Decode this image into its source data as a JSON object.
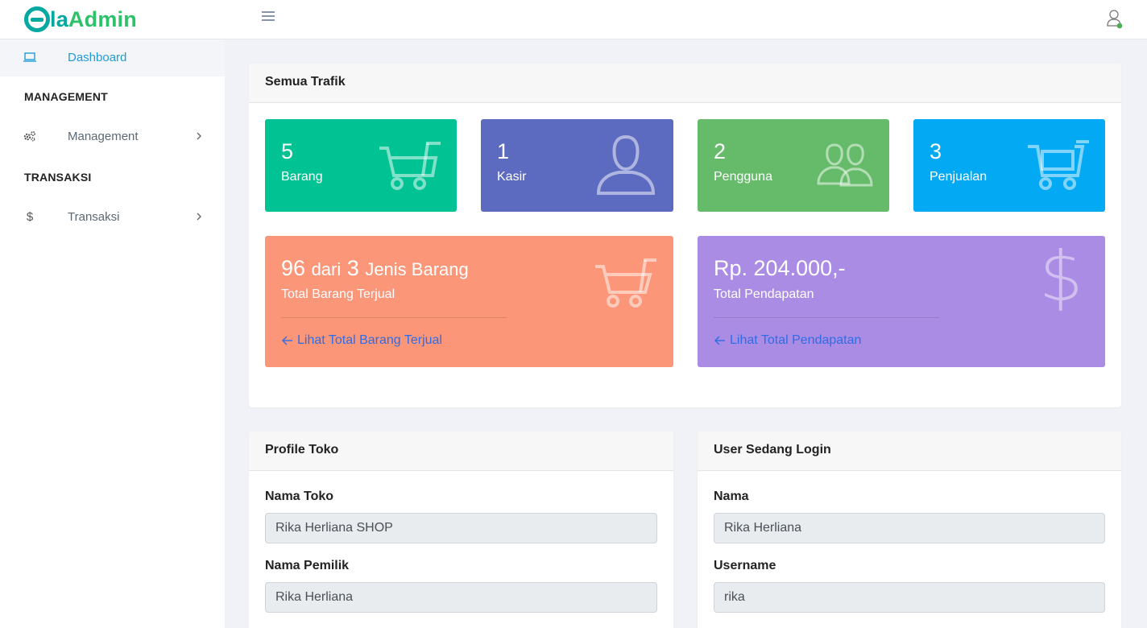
{
  "header": {
    "logo_prefix": "la",
    "logo_suffix": "Admin",
    "menu_icon": "hamburger-icon",
    "user_icon": "user-icon",
    "status_color": "#4caf50"
  },
  "sidebar": {
    "items": [
      {
        "label": "Dashboard",
        "icon": "laptop-icon",
        "active": true
      },
      {
        "label": "Management",
        "icon": "gears-icon",
        "active": false
      },
      {
        "label": "Transaksi",
        "icon": "dollar-icon",
        "active": false
      }
    ],
    "headings": [
      "MANAGEMENT",
      "TRANSAKSI"
    ]
  },
  "traffic": {
    "title": "Semua Trafik",
    "stats": [
      {
        "value": "5",
        "label": "Barang",
        "color": "#00c292",
        "icon": "cart-icon"
      },
      {
        "value": "1",
        "label": "Kasir",
        "color": "#5c6bc0",
        "icon": "user-icon"
      },
      {
        "value": "2",
        "label": "Pengguna",
        "color": "#66bb6a",
        "icon": "users-icon"
      },
      {
        "value": "3",
        "label": "Penjualan",
        "color": "#03a9f3",
        "icon": "basket-icon"
      }
    ],
    "sold": {
      "qty": "96",
      "of": "dari",
      "types": "3",
      "types_label": "Jenis Barang",
      "sub": "Total Barang Terjual",
      "link": "Lihat Total Barang Terjual",
      "color": "#fb9678"
    },
    "income": {
      "amount": "Rp. 204.000,-",
      "sub": "Total Pendapatan",
      "link": "Lihat Total Pendapatan",
      "color": "#ab8ce4"
    }
  },
  "profile": {
    "title": "Profile Toko",
    "fields": [
      {
        "label": "Nama Toko",
        "value": "Rika Herliana SHOP"
      },
      {
        "label": "Nama Pemilik",
        "value": "Rika Herliana"
      }
    ]
  },
  "login": {
    "title": "User Sedang Login",
    "fields": [
      {
        "label": "Nama",
        "value": "Rika Herliana"
      },
      {
        "label": "Username",
        "value": "rika"
      }
    ]
  }
}
